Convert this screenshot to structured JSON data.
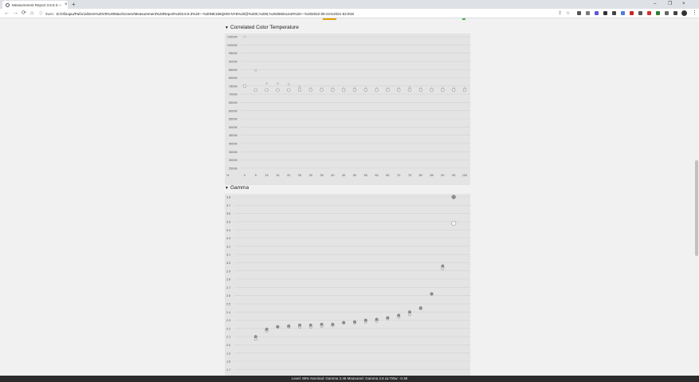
{
  "browser": {
    "tab_title": "Measurement Report 3.8.9.3 — %",
    "tab_close": "×",
    "new_tab": "+",
    "window_controls": [
      "–",
      "❐",
      "×"
    ],
    "omnibox_label": "Файл",
    "url": "D:/Обзоры/Работа/Dere%20V9%20Max/Screen/Measurement%20Report%203.8.9.3%20—%20NE156QHM-NY5%20@%200,%200,%202560x1440%20—%202022-08-21%2021-53.html",
    "icons": [
      "back-icon",
      "forward-icon",
      "reload-icon",
      "home-icon",
      "info-icon",
      "share-icon",
      "star-icon",
      "profile-icon",
      "menu-icon"
    ],
    "extension_colors": [
      "#555555",
      "#7a7a7a",
      "#5b5bd6",
      "#333333",
      "#444444",
      "#4f7be0",
      "#cc2222",
      "#555555",
      "#d03030",
      "#2e7d32",
      "#666666",
      "#444444",
      "#444444"
    ]
  },
  "sections": {
    "cct_title": "Correlated Color Temperature",
    "gamma_title": "Gamma"
  },
  "status": {
    "text": "Level: 95% Nominal: Gamma 3.48 Measured: Gamma 3.8 ΔL*00w: -0.38"
  },
  "chart_data": [
    {
      "type": "scatter",
      "title": "Correlated Color Temperature",
      "y_ticks": [
        "10500K",
        "10000K",
        "9500K",
        "9000K",
        "8500K",
        "8000K",
        "7500K",
        "7000K",
        "6500K",
        "6000K",
        "5500K",
        "5000K",
        "4500K",
        "4000K",
        "3500K",
        "3000K",
        "2500K"
      ],
      "x_ticks": [
        "%",
        "0",
        "5",
        "10",
        "15",
        "20",
        "25",
        "30",
        "35",
        "40",
        "45",
        "50",
        "55",
        "60",
        "65",
        "70",
        "75",
        "80",
        "85",
        "90",
        "95",
        "100"
      ],
      "ylim": [
        2500,
        10500
      ],
      "xlim": [
        0,
        100
      ],
      "grid": true,
      "series": [
        {
          "x": [
            0,
            5,
            10,
            15,
            20,
            25,
            30,
            35,
            40,
            45,
            50,
            55,
            60,
            65,
            70,
            75,
            80,
            85,
            90,
            95,
            100
          ],
          "values": [
            7500,
            7250,
            7250,
            7250,
            7250,
            7250,
            7250,
            7250,
            7250,
            7250,
            7250,
            7250,
            7250,
            7250,
            7250,
            7250,
            7250,
            7250,
            7250,
            7250,
            7250
          ]
        },
        {
          "x": [
            0,
            5,
            10,
            15,
            20,
            25,
            30,
            35,
            40,
            45,
            50,
            55,
            60,
            65,
            70,
            75,
            80,
            85,
            90,
            95,
            100
          ],
          "values": [
            10500,
            8450,
            7650,
            7650,
            7600,
            7450,
            7350,
            7350,
            7350,
            7350,
            7350,
            7350,
            7350,
            7350,
            7350,
            7400,
            7350,
            7350,
            7350,
            7350,
            7350
          ]
        }
      ]
    },
    {
      "type": "scatter",
      "title": "Gamma",
      "y_ticks": [
        "3.8",
        "3.7",
        "3.6",
        "3.5",
        "3.4",
        "3.3",
        "3.2",
        "3.1",
        "3.0",
        "2.9",
        "2.8",
        "2.7",
        "2.6",
        "2.5",
        "2.4",
        "2.3",
        "2.2",
        "2.1",
        "2.0",
        "1.9",
        "1.8",
        "1.7"
      ],
      "ylim": [
        1.7,
        3.8
      ],
      "xlim": [
        0,
        100
      ],
      "grid": true,
      "series": [
        {
          "x": [
            5,
            10,
            15,
            20,
            25,
            30,
            35,
            40,
            45,
            50,
            55,
            60,
            65,
            70,
            75,
            80,
            85,
            90,
            95
          ],
          "values": [
            2.07,
            2.17,
            2.22,
            2.22,
            2.22,
            2.22,
            2.23,
            2.24,
            2.27,
            2.27,
            2.28,
            2.29,
            2.32,
            2.34,
            2.37,
            2.44,
            2.62,
            2.93,
            3.48
          ]
        },
        {
          "x": [
            5,
            10,
            15,
            20,
            25,
            30,
            35,
            40,
            45,
            50,
            55,
            60,
            65,
            70,
            75,
            80,
            85,
            90,
            95
          ],
          "values": [
            2.1,
            2.19,
            2.22,
            2.23,
            2.24,
            2.24,
            2.25,
            2.25,
            2.27,
            2.28,
            2.3,
            2.31,
            2.33,
            2.36,
            2.4,
            2.45,
            2.62,
            2.96,
            3.8
          ]
        }
      ]
    }
  ]
}
